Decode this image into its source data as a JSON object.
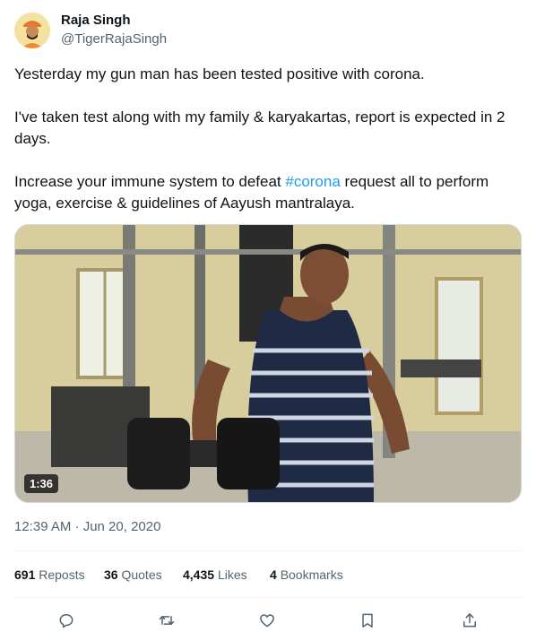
{
  "author": {
    "display_name": "Raja Singh",
    "handle": "@TigerRajaSingh"
  },
  "tweet": {
    "paragraph1": "Yesterday my gun man has been tested positive with corona.",
    "paragraph2": "I've taken test along with my family & karyakartas, report is expected in 2 days.",
    "paragraph3_before": "Increase your immune system to defeat ",
    "hashtag": "#corona",
    "paragraph3_after": " request all to perform yoga, exercise & guidelines of Aayush mantralaya.",
    "timestamp": "12:39 AM · Jun 20, 2020"
  },
  "media": {
    "duration": "1:36"
  },
  "stats": {
    "reposts_count": "691",
    "reposts_label": "Reposts",
    "quotes_count": "36",
    "quotes_label": "Quotes",
    "likes_count": "4,435",
    "likes_label": "Likes",
    "bookmarks_count": "4",
    "bookmarks_label": "Bookmarks"
  },
  "icons": {
    "reply": "reply-icon",
    "repost": "repost-icon",
    "like": "like-icon",
    "bookmark": "bookmark-icon",
    "share": "share-icon"
  },
  "colors": {
    "text": "#0f1419",
    "secondary": "#536471",
    "link": "#1d9bf0",
    "divider": "#eff3f4"
  }
}
